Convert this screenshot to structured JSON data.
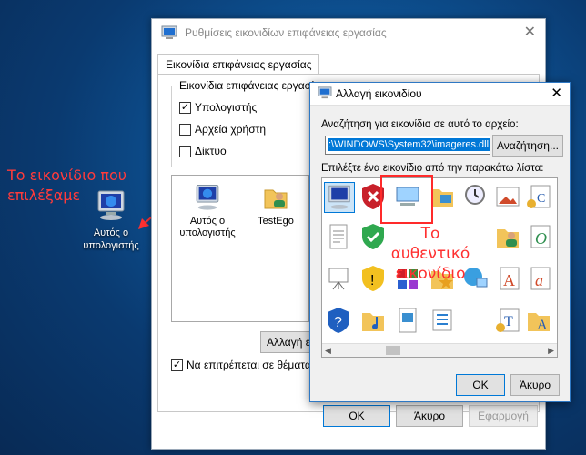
{
  "desktop": {
    "icon_label": "Αυτός ο υπολογιστής",
    "note": "Το εικονίδιο που επιλέξαμε"
  },
  "settings_dialog": {
    "title": "Ρυθμίσεις εικονιδίων επιφάνειας εργασίας",
    "tab": "Εικονίδια επιφάνειας εργασίας",
    "group_title": "Εικονίδια επιφάνειας εργασί",
    "checkboxes": [
      {
        "label": "Υπολογιστής",
        "checked": true
      },
      {
        "label": "Αρχεία χρήστη",
        "checked": false
      },
      {
        "label": "Δίκτυο",
        "checked": false
      }
    ],
    "icons": [
      {
        "label": "Αυτός ο υπολογιστής"
      },
      {
        "label": "TestEgo"
      }
    ],
    "change_icon_button": "Αλλαγή ε",
    "allow_themes": "Να επιτρέπεται σε θέματα",
    "ok": "OK",
    "cancel": "Άκυρο",
    "apply": "Εφαρμογή"
  },
  "change_icon_dialog": {
    "title": "Αλλαγή εικονιδίου",
    "search_label": "Αναζήτηση για εικονίδια σε αυτό το αρχείο:",
    "path_value": ":\\WINDOWS\\System32\\imageres.dll",
    "browse": "Αναζήτηση...",
    "select_label": "Επιλέξτε ένα εικονίδιο από την παρακάτω λίστα:",
    "ok": "OK",
    "cancel": "Άκυρο"
  },
  "annotation": {
    "original_icon": "Το αυθεντικό εικονίδιο"
  },
  "colors": {
    "accent": "#0078d7",
    "annotation_red": "#ff2a2a"
  }
}
